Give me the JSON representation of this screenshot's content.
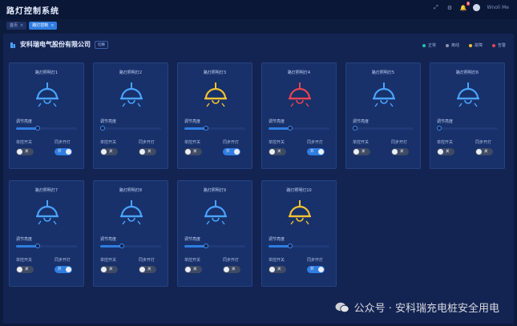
{
  "app": {
    "title": "路灯控制系统"
  },
  "topbar": {
    "user_name": "Wnoli Me",
    "notification_count": "9"
  },
  "tabs": [
    {
      "label": "首页",
      "active": false
    },
    {
      "label": "路灯控制",
      "active": true
    }
  ],
  "panel": {
    "company": "安科瑞电气股份有限公司",
    "switch_label": "切换",
    "legend": [
      {
        "label": "正常",
        "color": "#22c3aa"
      },
      {
        "label": "离线",
        "color": "#8c96aa"
      },
      {
        "label": "故障",
        "color": "#f2c230"
      },
      {
        "label": "告警",
        "color": "#e8434f"
      }
    ]
  },
  "card_labels": {
    "brightness": "调节亮度",
    "single": "单控开关",
    "sync": "同步开灯",
    "on": "开",
    "off": "关"
  },
  "lamps": [
    {
      "name": "路灯照明灯1",
      "status_color": "#4aa3ff",
      "brightness": 0.35,
      "single_on": false,
      "sync_on": true
    },
    {
      "name": "路灯照明灯2",
      "status_color": "#4aa3ff",
      "brightness": 0.0,
      "single_on": false,
      "sync_on": false
    },
    {
      "name": "路灯照明灯3",
      "status_color": "#f2c230",
      "brightness": 0.35,
      "single_on": false,
      "sync_on": true
    },
    {
      "name": "路灯照明灯4",
      "status_color": "#e8434f",
      "brightness": 0.35,
      "single_on": false,
      "sync_on": true
    },
    {
      "name": "路灯照明灯5",
      "status_color": "#4aa3ff",
      "brightness": 0.0,
      "single_on": false,
      "sync_on": false
    },
    {
      "name": "路灯照明灯6",
      "status_color": "#4aa3ff",
      "brightness": 0.0,
      "single_on": false,
      "sync_on": false
    },
    {
      "name": "路灯照明灯7",
      "status_color": "#4aa3ff",
      "brightness": 0.35,
      "single_on": false,
      "sync_on": true
    },
    {
      "name": "路灯照明灯8",
      "status_color": "#4aa3ff",
      "brightness": 0.35,
      "single_on": false,
      "sync_on": false
    },
    {
      "name": "路灯照明灯9",
      "status_color": "#4aa3ff",
      "brightness": 0.35,
      "single_on": false,
      "sync_on": false
    },
    {
      "name": "路灯照明灯10",
      "status_color": "#f2c230",
      "brightness": 0.35,
      "single_on": false,
      "sync_on": true
    }
  ],
  "watermark": {
    "text": "公众号 · 安科瑞充电桩安全用电"
  }
}
